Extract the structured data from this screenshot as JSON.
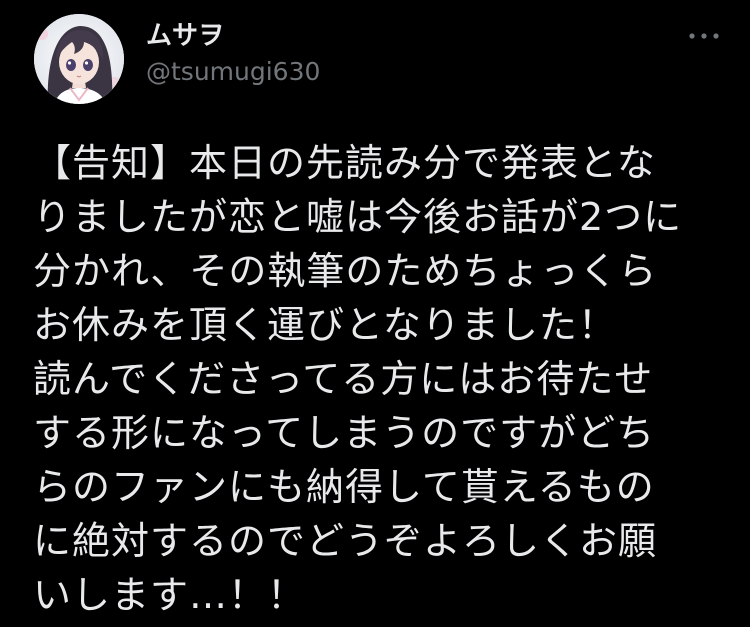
{
  "author": {
    "display_name": "ムサヲ",
    "handle": "@tsumugi630",
    "avatar_icon": "anime-girl-avatar-icon"
  },
  "menu": {
    "icon": "more-options-icon"
  },
  "tweet": {
    "lines": [
      "【告知】本日の先読み分で発表とな",
      "りましたが恋と嘘は今後お話が2つに",
      "分かれ、その執筆のためちょっくら",
      "お休みを頂く運びとなりました！",
      "読んでくださってる方にはお待たせ",
      "する形になってしまうのですがどち",
      "らのファンにも納得して貰えるもの",
      "に絶対するのでどうぞよろしくお願",
      "いします…！！"
    ]
  },
  "colors": {
    "background": "#000000",
    "text_primary": "#e7e9ea",
    "text_secondary": "#71767b"
  }
}
